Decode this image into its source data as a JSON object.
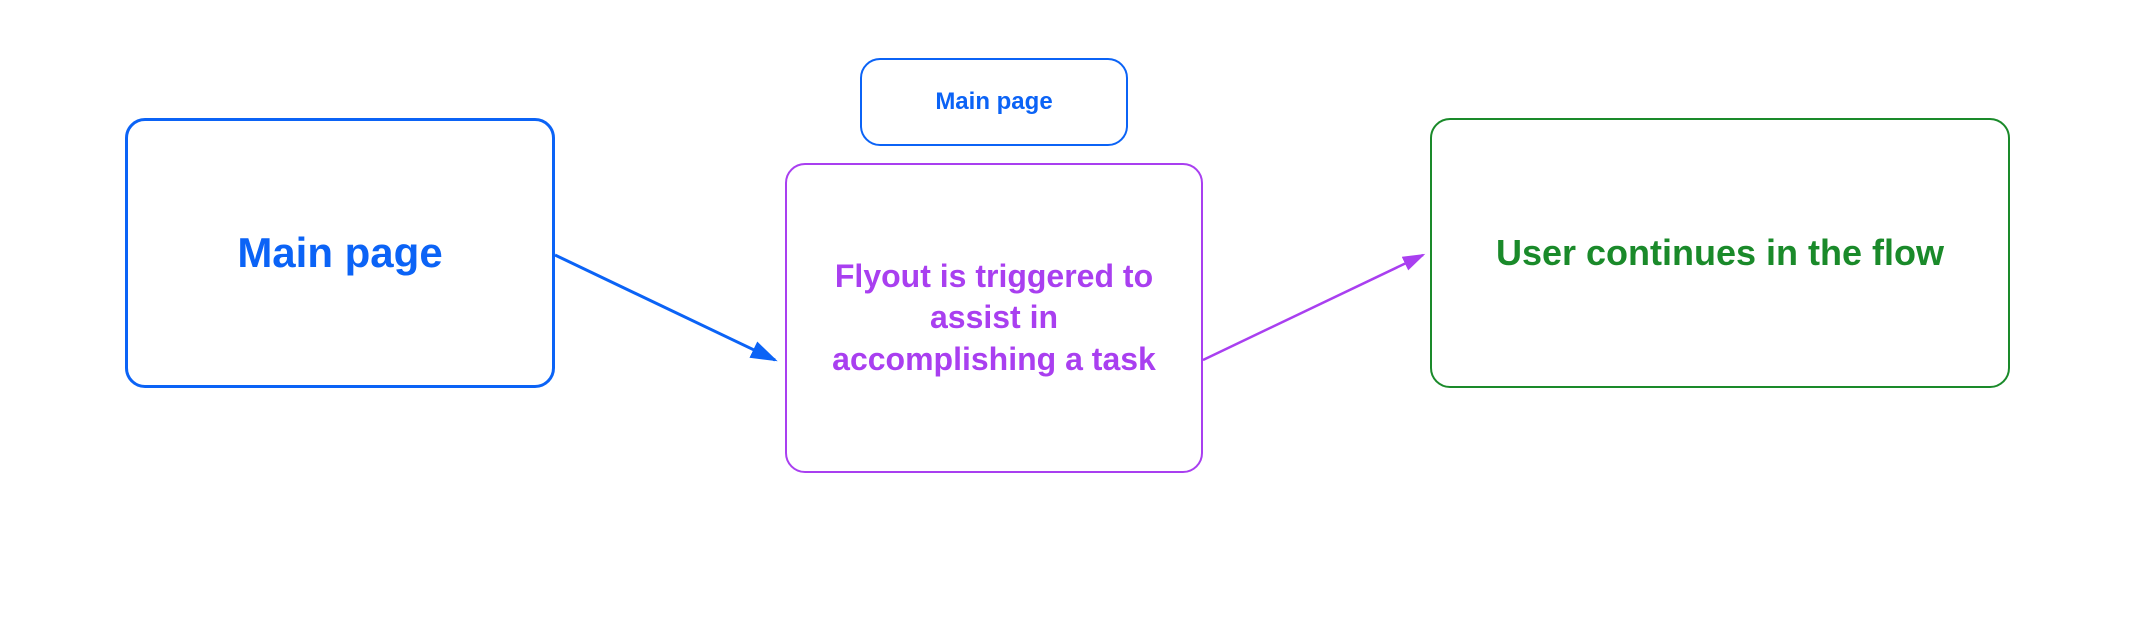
{
  "diagram": {
    "step1": {
      "label": "Main page",
      "color": "#0b63f6"
    },
    "step2_small": {
      "label": "Main page",
      "color": "#0b63f6"
    },
    "step2_flyout": {
      "label": "Flyout is triggered to assist in accomplishing a task",
      "color": "#a93ff0"
    },
    "step3": {
      "label": "User continues in the flow",
      "color": "#1a8a2a"
    },
    "arrows": {
      "arrow1_color": "#0b63f6",
      "arrow2_color": "#a93ff0"
    }
  }
}
